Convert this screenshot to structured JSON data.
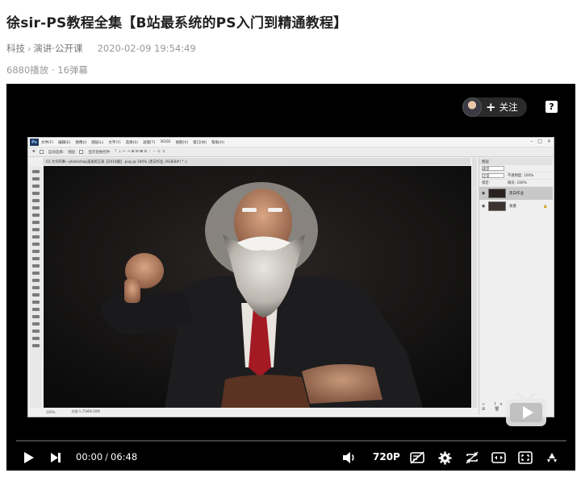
{
  "video": {
    "title": "徐sir-PS教程全集【B站最系统的PS入门到精通教程】",
    "category": "科技",
    "subcategory": "演讲·公开课",
    "date": "2020-02-09 19:54:49",
    "plays": "6880播放",
    "dot": " · ",
    "danmaku": "16弹幕"
  },
  "uploader": {
    "follow_label": "关注",
    "plus": "+"
  },
  "help": {
    "label": "?"
  },
  "photoshop": {
    "logo": "Ps",
    "menu": [
      "文件(F)",
      "编辑(E)",
      "图像(I)",
      "图层(L)",
      "文字(Y)",
      "选择(S)",
      "滤镜(T)",
      "3D(D)",
      "视图(V)",
      "窗口(W)",
      "帮助(H)"
    ],
    "options": [
      "自动选择:",
      "图层",
      "显示变换控件"
    ],
    "doc_tab": "01 大众的事—photoshop美丽的言表【2018版】.png @ 100% (黑白作业, RGB/8#) *  ×",
    "status": [
      "100%",
      "文档:1.71M/6.00M"
    ],
    "panel_title": "图层",
    "panel_rows": [
      {
        "label": "类型",
        "value": ""
      },
      {
        "label": "正常",
        "value": "不透明度: 100%"
      },
      {
        "label": "锁定:",
        "value": "填充: 100%"
      }
    ],
    "layers": [
      {
        "name": "黑白作业",
        "selected": true
      },
      {
        "name": "背景",
        "selected": false
      }
    ],
    "panel_footer": "∞ fx ◘ ◎ ▭ ⊞ 🗑"
  },
  "player": {
    "current_time": "00:00",
    "separator": "/",
    "duration": "06:48",
    "quality": "720P",
    "progress": 0
  }
}
